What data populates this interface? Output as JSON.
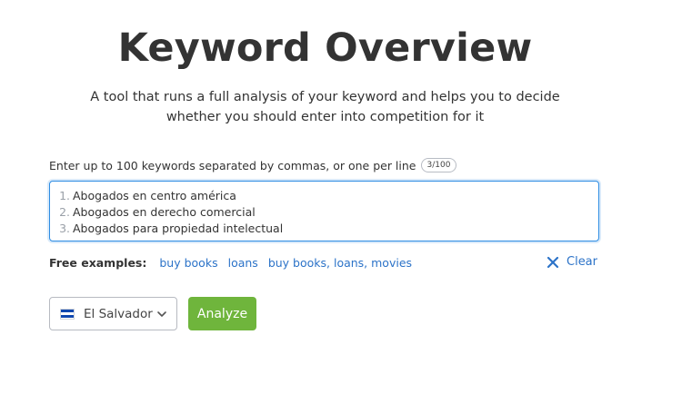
{
  "header": {
    "title": "Keyword Overview",
    "subtitle_line1": "A tool that runs a full analysis of your keyword and helps you to decide",
    "subtitle_line2": "whether you should enter into competition for it"
  },
  "input": {
    "label": "Enter up to 100 keywords separated by commas, or one per line",
    "counter": "3/100",
    "keywords": [
      {
        "num": "1.",
        "text": "Abogados en centro américa"
      },
      {
        "num": "2.",
        "text": "Abogados en derecho comercial"
      },
      {
        "num": "3.",
        "text": "Abogados para propiedad intelectual"
      }
    ]
  },
  "examples": {
    "label": "Free examples:",
    "items": [
      "buy books",
      "loans",
      "buy books, loans, movies"
    ]
  },
  "clear": {
    "label": "Clear",
    "icon": "close-icon"
  },
  "database": {
    "selected": "El Salvador",
    "flag": "el-salvador-flag",
    "icon": "chevron-down-icon"
  },
  "actions": {
    "analyze_label": "Analyze"
  },
  "colors": {
    "accent_blue": "#2c73c8",
    "focus_border": "#2d8ce3",
    "analyze_green": "#6fb53c",
    "text": "#333333"
  }
}
